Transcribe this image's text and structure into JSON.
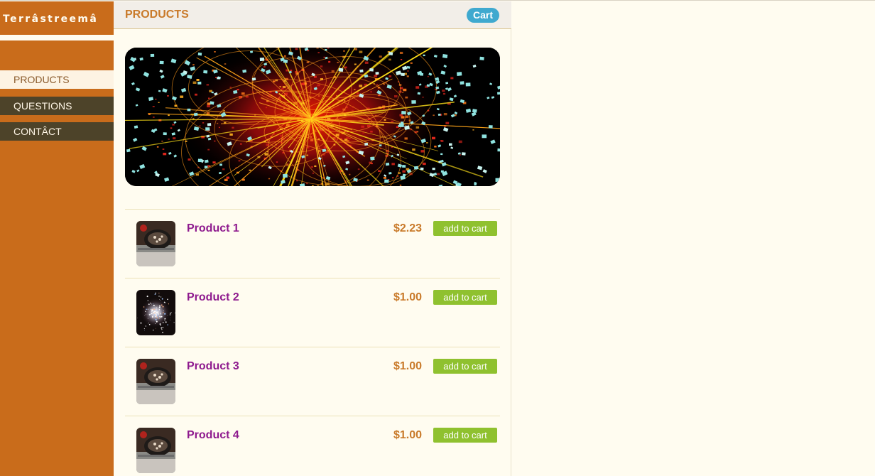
{
  "brand": {
    "logo_text": "Terrâstreemâ"
  },
  "sidebar": {
    "items": [
      {
        "label": "PRODUCTS",
        "active": true
      },
      {
        "label": "QUESTIONS",
        "active": false
      },
      {
        "label": "CONTÂCT",
        "active": false
      }
    ]
  },
  "header": {
    "title": "PRODUCTS",
    "cart_label": "Cart"
  },
  "hero": {
    "icon": "particle-collision-image"
  },
  "products": [
    {
      "name": "Product 1",
      "price": "$2.23",
      "button": "add to cart",
      "thumb": "skillet-photo"
    },
    {
      "name": "Product 2",
      "price": "$1.00",
      "button": "add to cart",
      "thumb": "star-cluster-photo"
    },
    {
      "name": "Product 3",
      "price": "$1.00",
      "button": "add to cart",
      "thumb": "skillet-photo"
    },
    {
      "name": "Product 4",
      "price": "$1.00",
      "button": "add to cart",
      "thumb": "skillet-photo"
    }
  ],
  "colors": {
    "sidebar": "#c96c1b",
    "nav_dark": "#4d4329",
    "product_name": "#8e1a8e",
    "price": "#c97a2a",
    "add_button": "#8fc12f",
    "cart_pill": "#3fa9cf",
    "background": "#fffcf0"
  }
}
